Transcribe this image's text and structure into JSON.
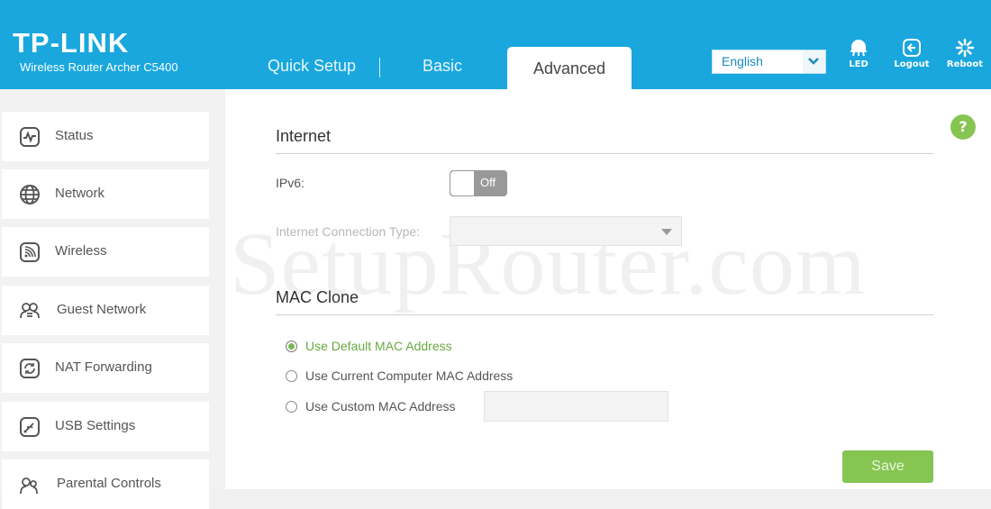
{
  "header": {
    "brand": "TP-LINK",
    "model": "Wireless Router Archer C5400",
    "tabs": [
      {
        "label": "Quick Setup",
        "active": false
      },
      {
        "label": "Basic",
        "active": false
      },
      {
        "label": "Advanced",
        "active": true
      }
    ],
    "language": {
      "selected": "English"
    },
    "actions": [
      {
        "label": "LED",
        "icon": "led-icon"
      },
      {
        "label": "Logout",
        "icon": "logout-icon"
      },
      {
        "label": "Reboot",
        "icon": "reboot-icon"
      }
    ]
  },
  "sidebar": {
    "items": [
      {
        "label": "Status",
        "icon": "status-icon"
      },
      {
        "label": "Network",
        "icon": "globe-icon"
      },
      {
        "label": "Wireless",
        "icon": "wireless-icon"
      },
      {
        "label": "Guest Network",
        "icon": "guest-network-icon"
      },
      {
        "label": "NAT Forwarding",
        "icon": "nat-forwarding-icon"
      },
      {
        "label": "USB Settings",
        "icon": "usb-icon"
      },
      {
        "label": "Parental Controls",
        "icon": "parental-controls-icon"
      }
    ]
  },
  "main": {
    "help_icon": "?",
    "internet": {
      "title": "Internet",
      "ipv6_label": "IPv6:",
      "ipv6_toggle": "Off",
      "connection_type_label": "Internet Connection Type:",
      "connection_type_value": ""
    },
    "mac_clone": {
      "title": "MAC Clone",
      "options": [
        {
          "label": "Use Default MAC Address",
          "selected": true
        },
        {
          "label": "Use Current Computer MAC Address",
          "selected": false
        },
        {
          "label": "Use Custom MAC Address",
          "selected": false
        }
      ],
      "custom_mac_value": ""
    },
    "save_label": "Save"
  },
  "watermark": "SetupRouter.com",
  "colors": {
    "header": "#19a7dd",
    "accent_green": "#86c552",
    "selected_text": "#6aa842"
  }
}
